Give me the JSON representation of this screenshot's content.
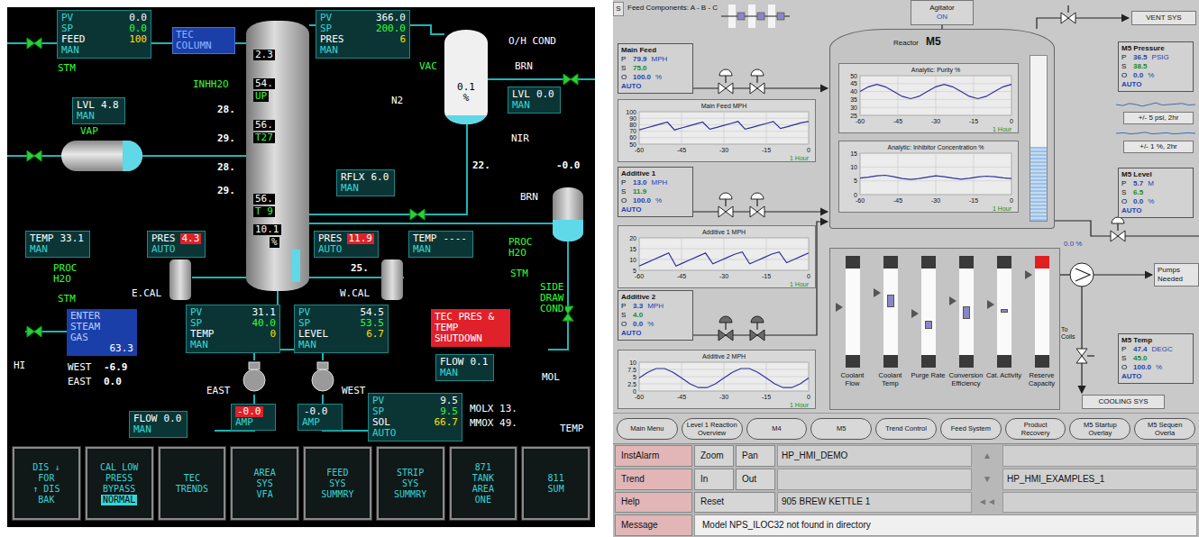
{
  "left": {
    "tec_column": "TEC COLUMN",
    "shutdown": "TEC PRES & TEMP SHUTDOWN",
    "faceplates": [
      {
        "rows": [
          {
            "k": "PV",
            "v": "0.0"
          },
          {
            "k": "SP",
            "v": "0.0"
          },
          {
            "k": "FEED",
            "v": "100"
          }
        ],
        "mode": "MAN"
      },
      {
        "rows": [
          {
            "k": "PV",
            "v": "366.0"
          },
          {
            "k": "SP",
            "v": "200.0"
          },
          {
            "k": "PRES",
            "v": "6"
          }
        ],
        "mode": "MAN"
      },
      {
        "rows": [
          {
            "k": "PV",
            "v": "31.1"
          },
          {
            "k": "SP",
            "v": "40.0"
          },
          {
            "k": "TEMP",
            "v": "0"
          }
        ],
        "mode": "MAN"
      },
      {
        "rows": [
          {
            "k": "PV",
            "v": "54.5"
          },
          {
            "k": "SP",
            "v": "53.5"
          },
          {
            "k": "LEVEL",
            "v": "6.7"
          }
        ],
        "mode": "MAN"
      },
      {
        "rows": [
          {
            "k": "PV",
            "v": "9.5"
          },
          {
            "k": "SP",
            "v": "9.5"
          },
          {
            "k": "SOL",
            "v": "66.7"
          }
        ],
        "mode": "AUTO"
      }
    ],
    "tags": [
      {
        "tag": "LVL",
        "value": "4.8",
        "mode": "MAN",
        "alarm": false
      },
      {
        "tag": "LVL",
        "value": "0.0",
        "mode": "MAN",
        "alarm": false
      },
      {
        "tag": "RFLX",
        "value": "6.0",
        "mode": "MAN",
        "alarm": false
      },
      {
        "tag": "TEMP",
        "value": "33.1",
        "mode": "MAN",
        "alarm": false
      },
      {
        "tag": "PRES",
        "value": "4.3",
        "mode": "AUTO",
        "alarm": true
      },
      {
        "tag": "PRES",
        "value": "11.9",
        "mode": "AUTO",
        "alarm": true
      },
      {
        "tag": "TEMP",
        "value": "----",
        "mode": "MAN",
        "alarm": false
      },
      {
        "tag": "FLOW",
        "value": "0.1",
        "mode": "MAN",
        "alarm": false
      },
      {
        "tag": "FLOW",
        "value": "0.0",
        "mode": "MAN",
        "alarm": false
      },
      {
        "value": "-0.0",
        "mode": "AMP",
        "alarm": true
      },
      {
        "value": "-0.0",
        "mode": "AMP",
        "alarm": false
      }
    ],
    "column": {
      "readings": [
        {
          "text": "2.3",
          "kind": "reading"
        },
        {
          "text": "54.",
          "kind": "reading"
        },
        {
          "text": "UP",
          "kind": "value"
        },
        {
          "text": "56.",
          "kind": "reading"
        },
        {
          "text": "T27",
          "kind": "value"
        },
        {
          "text": "56.",
          "kind": "reading"
        },
        {
          "text": "T 9",
          "kind": "value"
        }
      ],
      "value": "10.1",
      "unit": "%",
      "level": 0.12
    },
    "drum": {
      "value": "0.1",
      "unit": "%",
      "level": 0.1
    },
    "steam": {
      "lines": [
        "ENTER",
        "STEAM",
        "GAS"
      ],
      "value": "63.3"
    },
    "labels": [
      {
        "text": "O/H COND",
        "kind": "label"
      },
      {
        "text": "VAC",
        "kind": "value"
      },
      {
        "text": "BRN",
        "kind": "label"
      },
      {
        "text": "N2",
        "kind": "label"
      },
      {
        "text": "NIR",
        "kind": "label"
      },
      {
        "text": "-0.0",
        "kind": "reading"
      },
      {
        "text": "22.",
        "kind": "reading"
      },
      {
        "text": "STM",
        "kind": "value"
      },
      {
        "text": "VAP",
        "kind": "value"
      },
      {
        "text": "INHH2O",
        "kind": "value"
      },
      {
        "text": "28.",
        "kind": "reading"
      },
      {
        "text": "29.",
        "kind": "reading"
      },
      {
        "text": "28.",
        "kind": "reading"
      },
      {
        "text": "29.",
        "kind": "reading"
      },
      {
        "text": "PROC",
        "kind": "value"
      },
      {
        "text": "H2O",
        "kind": "value"
      },
      {
        "text": "STM",
        "kind": "value"
      },
      {
        "text": "E.CAL",
        "kind": "label"
      },
      {
        "text": "W.CAL",
        "kind": "label"
      },
      {
        "text": "25.",
        "kind": "reading"
      },
      {
        "text": "PROC",
        "kind": "value"
      },
      {
        "text": "H2O",
        "kind": "value"
      },
      {
        "text": "STM",
        "kind": "value"
      },
      {
        "text": "SIDE",
        "kind": "value"
      },
      {
        "text": "DRAW",
        "kind": "value"
      },
      {
        "text": "COND",
        "kind": "value"
      },
      {
        "text": "BRN",
        "kind": "label"
      },
      {
        "text": "MOL",
        "kind": "label"
      },
      {
        "text": "EAST",
        "kind": "label"
      },
      {
        "text": "WEST",
        "kind": "label"
      },
      {
        "text": "MOLX 13.",
        "kind": "label"
      },
      {
        "text": "MMOX 49.",
        "kind": "label"
      },
      {
        "text": "HI",
        "kind": "label"
      },
      {
        "text": "WEST",
        "kind": "label"
      },
      {
        "text": "-6.9",
        "kind": "reading"
      },
      {
        "text": "EAST",
        "kind": "label"
      },
      {
        "text": "0.0",
        "kind": "reading"
      },
      {
        "text": "TEMP",
        "kind": "label"
      }
    ],
    "buttons": [
      {
        "lines": [
          "DIS  ↓",
          "FOR",
          "↑ DIS",
          "BAK"
        ]
      },
      {
        "lines": [
          "CAL LOW",
          "PRESS",
          "BYPASS"
        ],
        "status": "NORMAL"
      },
      {
        "lines": [
          "TEC",
          "TRENDS"
        ]
      },
      {
        "lines": [
          "AREA",
          "SYS",
          "VFA"
        ]
      },
      {
        "lines": [
          "FEED",
          "SYS",
          "SUMMRY"
        ]
      },
      {
        "lines": [
          "STRIP",
          "SYS",
          "SUMMRY"
        ]
      },
      {
        "lines": [
          "871",
          "TANK",
          "AREA",
          "ONE"
        ]
      },
      {
        "lines": [
          "811",
          "SUM"
        ]
      }
    ]
  },
  "right": {
    "corner": "S",
    "feed_components": "Feed Components: A - B - C",
    "agitator": {
      "label": "Agitator",
      "state": "ON"
    },
    "reactor": {
      "title": "Reactor",
      "name": "M5",
      "level": 0.45
    },
    "vent": "VENT SYS",
    "feeds": [
      {
        "title": "Main Feed",
        "rows": [
          {
            "key": "P",
            "value": "79.9",
            "unit": "MPH"
          },
          {
            "key": "S",
            "value": "75.0"
          },
          {
            "key": "O",
            "value": "100.0",
            "unit": "%"
          }
        ],
        "mode": "AUTO",
        "valve_open": true
      },
      {
        "title": "Additive 1",
        "rows": [
          {
            "key": "P",
            "value": "13.0",
            "unit": "MPH"
          },
          {
            "key": "S",
            "value": "11.9"
          },
          {
            "key": "O",
            "value": "100.0",
            "unit": "%"
          }
        ],
        "mode": "AUTO",
        "valve_open": true
      },
      {
        "title": "Additive 2",
        "rows": [
          {
            "key": "P",
            "value": "3.3",
            "unit": "MPH"
          },
          {
            "key": "S",
            "value": "4.0"
          },
          {
            "key": "O",
            "value": "0.0",
            "unit": "%"
          }
        ],
        "mode": "AUTO",
        "valve_open": false
      }
    ],
    "feed_charts": [
      {
        "title": "Main Feed MPH",
        "y_ticks": [
          "100",
          "90",
          "80",
          "70",
          "60",
          "50"
        ],
        "x_ticks": [
          "-60",
          "-45",
          "-30",
          "-15",
          "0"
        ],
        "span": "1 Hour",
        "values": [
          72,
          75,
          78,
          81,
          84,
          72,
          75,
          78,
          81,
          84,
          73,
          76,
          79,
          82,
          85,
          73,
          76,
          79,
          82,
          85,
          74,
          77,
          80,
          83,
          85
        ]
      },
      {
        "title": "Additive 1 MPH",
        "y_ticks": [
          "20",
          "15",
          "10",
          "5"
        ],
        "x_ticks": [
          "-60",
          "-45",
          "-30",
          "-15",
          "0"
        ],
        "span": "1 Hour",
        "values": [
          7,
          8.5,
          10,
          11.5,
          13,
          7,
          8.5,
          10,
          11.5,
          13,
          8,
          9.5,
          11,
          12.5,
          13.5,
          8,
          9.5,
          11,
          12.5,
          13.5,
          8.5,
          10,
          11.5,
          13
        ]
      },
      {
        "title": "Additive 2 MPH",
        "y_ticks": [
          "10",
          "7.5",
          "5",
          "2.5",
          "0"
        ],
        "x_ticks": [
          "-60",
          "-45",
          "-30",
          "-15",
          "0"
        ],
        "span": "1 Hour",
        "values": [
          4.5,
          6.5,
          7.8,
          7.8,
          6.5,
          4.5,
          2.5,
          1.2,
          1.2,
          2.5,
          4.5,
          6.5,
          7.8,
          7.8,
          6.5,
          4.5,
          2.5,
          1.2,
          1.2,
          2.5,
          4.5
        ]
      }
    ],
    "reactor_charts": [
      {
        "title": "Analytic: Purity %",
        "y_ticks": [
          "50",
          "45",
          "40",
          "35",
          "30",
          "25"
        ],
        "x_ticks": [
          "-60",
          "-45",
          "-30",
          "-15",
          "0"
        ],
        "span": "1 Hour",
        "values": [
          40,
          43,
          44.5,
          43,
          40,
          37,
          35.5,
          37,
          40,
          43,
          44.5,
          43,
          40,
          37,
          35.5,
          37,
          40,
          43,
          44.5
        ]
      },
      {
        "title": "Analytic: Inhibitor Concentration %",
        "y_ticks": [
          "15",
          "10",
          "5",
          "0"
        ],
        "x_ticks": [
          "-60",
          "-45",
          "-30",
          "-15",
          "0"
        ],
        "span": "1 Hour",
        "values": [
          6,
          6.3,
          6.8,
          7,
          6.5,
          5.8,
          5.5,
          5.8,
          6.3,
          6.8,
          6.5,
          6,
          5.6,
          5.9,
          6.4,
          6.7,
          6.5,
          6.1,
          5.8
        ]
      }
    ],
    "faceplates": [
      {
        "title": "M5 Pressure",
        "rows": [
          {
            "key": "P",
            "value": "36.5",
            "unit": "PSIG"
          },
          {
            "key": "S",
            "value": "38.5"
          },
          {
            "key": "O",
            "value": "0.0",
            "unit": "%"
          }
        ],
        "mode": "AUTO"
      },
      {
        "title": "M5 Level",
        "rows": [
          {
            "key": "P",
            "value": "5.7",
            "unit": "M"
          },
          {
            "key": "S",
            "value": "6.5"
          },
          {
            "key": "O",
            "value": "0.0",
            "unit": "%"
          }
        ],
        "mode": "AUTO"
      },
      {
        "title": "M5 Temp",
        "rows": [
          {
            "key": "P",
            "value": "47.4",
            "unit": "DEGC"
          },
          {
            "key": "S",
            "value": "45.0"
          },
          {
            "key": "O",
            "value": "100.0",
            "unit": "%"
          }
        ],
        "mode": "AUTO"
      }
    ],
    "tolerances": [
      {
        "label": "+/- 5 psi, 2hr",
        "values": [
          5,
          4,
          6,
          5,
          3.5,
          5,
          6.5,
          4.5,
          5,
          5.5,
          6,
          4.5,
          5
        ]
      },
      {
        "label": "+/- 1 %, 2hr",
        "values": [
          5,
          5.5,
          4.5,
          5,
          6,
          4.5,
          5,
          5.5,
          4.5,
          5,
          5.5,
          5
        ]
      }
    ],
    "valve_reading": "0.0 %",
    "pumps": "Pumps Needed",
    "coils": "To Coils",
    "cooling": "COOLING SYS",
    "gauges": [
      {
        "label": "Coolant Flow",
        "level": 0.55,
        "band_low": 0.55,
        "band_high": 0.55,
        "alarm": false
      },
      {
        "label": "Coolant Temp",
        "level": 0.72,
        "band_low": 0.55,
        "band_high": 0.7,
        "alarm": false
      },
      {
        "label": "Purge Rate",
        "level": 0.48,
        "band_low": 0.3,
        "band_high": 0.4,
        "alarm": false
      },
      {
        "label": "Conversion Efficiency",
        "level": 0.62,
        "band_low": 0.42,
        "band_high": 0.56,
        "alarm": false
      },
      {
        "label": "Cat. Activity",
        "level": 0.58,
        "band_low": 0.49,
        "band_high": 0.53,
        "alarm": false
      },
      {
        "label": "Reserve Capacity",
        "level": 0.93,
        "band_low": 0.93,
        "band_high": 0.93,
        "alarm": true
      }
    ],
    "nav": [
      "Main Menu",
      "Level 1 Reaction Overview",
      "M4",
      "M5",
      "Trend Control",
      "Feed System",
      "Product Recovery",
      "M5 Startup Overlay",
      "M5 Sequen Overla"
    ],
    "command_rows": [
      {
        "buttons": [
          "InstAlarm",
          "Zoom",
          "Pan"
        ],
        "field": "HP_HMI_DEMO",
        "arrow": "▲",
        "field2": ""
      },
      {
        "buttons": [
          "Trend",
          "In",
          "Out"
        ],
        "field": "",
        "arrow": "▼",
        "field2": "HP_HMI_EXAMPLES_1"
      },
      {
        "buttons": [
          "Help",
          "Reset"
        ],
        "field": "905 BREW KETTLE 1",
        "arrow": "◄◄",
        "field2": ""
      }
    ],
    "message": {
      "label": "Message",
      "text": "Model NPS_ILOC32 not found in directory"
    }
  }
}
